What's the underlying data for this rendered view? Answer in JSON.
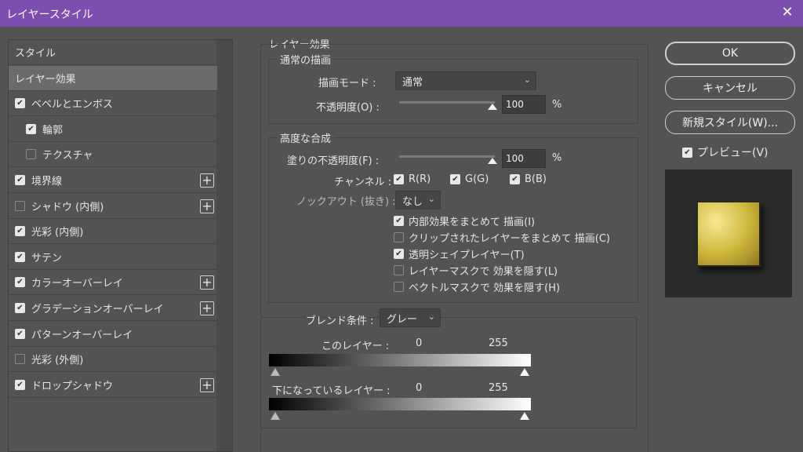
{
  "window": {
    "title": "レイヤースタイル"
  },
  "left_panel": {
    "items": [
      {
        "label": "スタイル",
        "checkbox": null,
        "selected": false,
        "add": false,
        "indent": false
      },
      {
        "label": "レイヤー効果",
        "checkbox": null,
        "selected": true,
        "add": false,
        "indent": false
      },
      {
        "label": "ベベルとエンボス",
        "checkbox": true,
        "selected": false,
        "add": false,
        "indent": false
      },
      {
        "label": "輪郭",
        "checkbox": true,
        "selected": false,
        "add": false,
        "indent": true
      },
      {
        "label": "テクスチャ",
        "checkbox": false,
        "selected": false,
        "add": false,
        "indent": true
      },
      {
        "label": "境界線",
        "checkbox": true,
        "selected": false,
        "add": true,
        "indent": false
      },
      {
        "label": "シャドウ (内側)",
        "checkbox": false,
        "selected": false,
        "add": true,
        "indent": false
      },
      {
        "label": "光彩 (内側)",
        "checkbox": true,
        "selected": false,
        "add": false,
        "indent": false
      },
      {
        "label": "サテン",
        "checkbox": true,
        "selected": false,
        "add": false,
        "indent": false
      },
      {
        "label": "カラーオーバーレイ",
        "checkbox": true,
        "selected": false,
        "add": true,
        "indent": false
      },
      {
        "label": "グラデーションオーバーレイ",
        "checkbox": true,
        "selected": false,
        "add": true,
        "indent": false
      },
      {
        "label": "パターンオーバーレイ",
        "checkbox": true,
        "selected": false,
        "add": false,
        "indent": false
      },
      {
        "label": "光彩 (外側)",
        "checkbox": false,
        "selected": false,
        "add": false,
        "indent": false
      },
      {
        "label": "ドロップシャドウ",
        "checkbox": true,
        "selected": false,
        "add": true,
        "indent": false
      }
    ]
  },
  "main": {
    "section_title": "レイヤー効果",
    "normal": {
      "title": "通常の描画",
      "blend_mode_label": "描画モード :",
      "blend_mode_value": "通常",
      "opacity_label": "不透明度(O) :",
      "opacity_value": "100",
      "opacity_unit": "%"
    },
    "advanced": {
      "title": "高度な合成",
      "fill_opacity_label": "塗りの不透明度(F) :",
      "fill_opacity_value": "100",
      "fill_opacity_unit": "%",
      "channels_label": "チャンネル :",
      "channel_r": "R(R)",
      "channel_g": "G(G)",
      "channel_b": "B(B)",
      "knockout_label": "ノックアウト (抜き) :",
      "knockout_value": "なし",
      "options": [
        {
          "label": "内部効果をまとめて 描画(I)",
          "checked": true
        },
        {
          "label": "クリップされたレイヤーをまとめて 描画(C)",
          "checked": false
        },
        {
          "label": "透明シェイプレイヤー(T)",
          "checked": true
        },
        {
          "label": "レイヤーマスクで 効果を隠す(L)",
          "checked": false
        },
        {
          "label": "ベクトルマスクで 効果を隠す(H)",
          "checked": false
        }
      ]
    },
    "blend_if": {
      "label": "ブレンド条件 :",
      "value": "グレー",
      "this_layer_label": "このレイヤー :",
      "this_layer_min": "0",
      "this_layer_max": "255",
      "underlying_label": "下になっているレイヤー :",
      "underlying_min": "0",
      "underlying_max": "255"
    }
  },
  "right": {
    "ok": "OK",
    "cancel": "キャンセル",
    "new_style": "新規スタイル(W)...",
    "preview_label": "プレビュー(V)",
    "preview_checked": true
  }
}
